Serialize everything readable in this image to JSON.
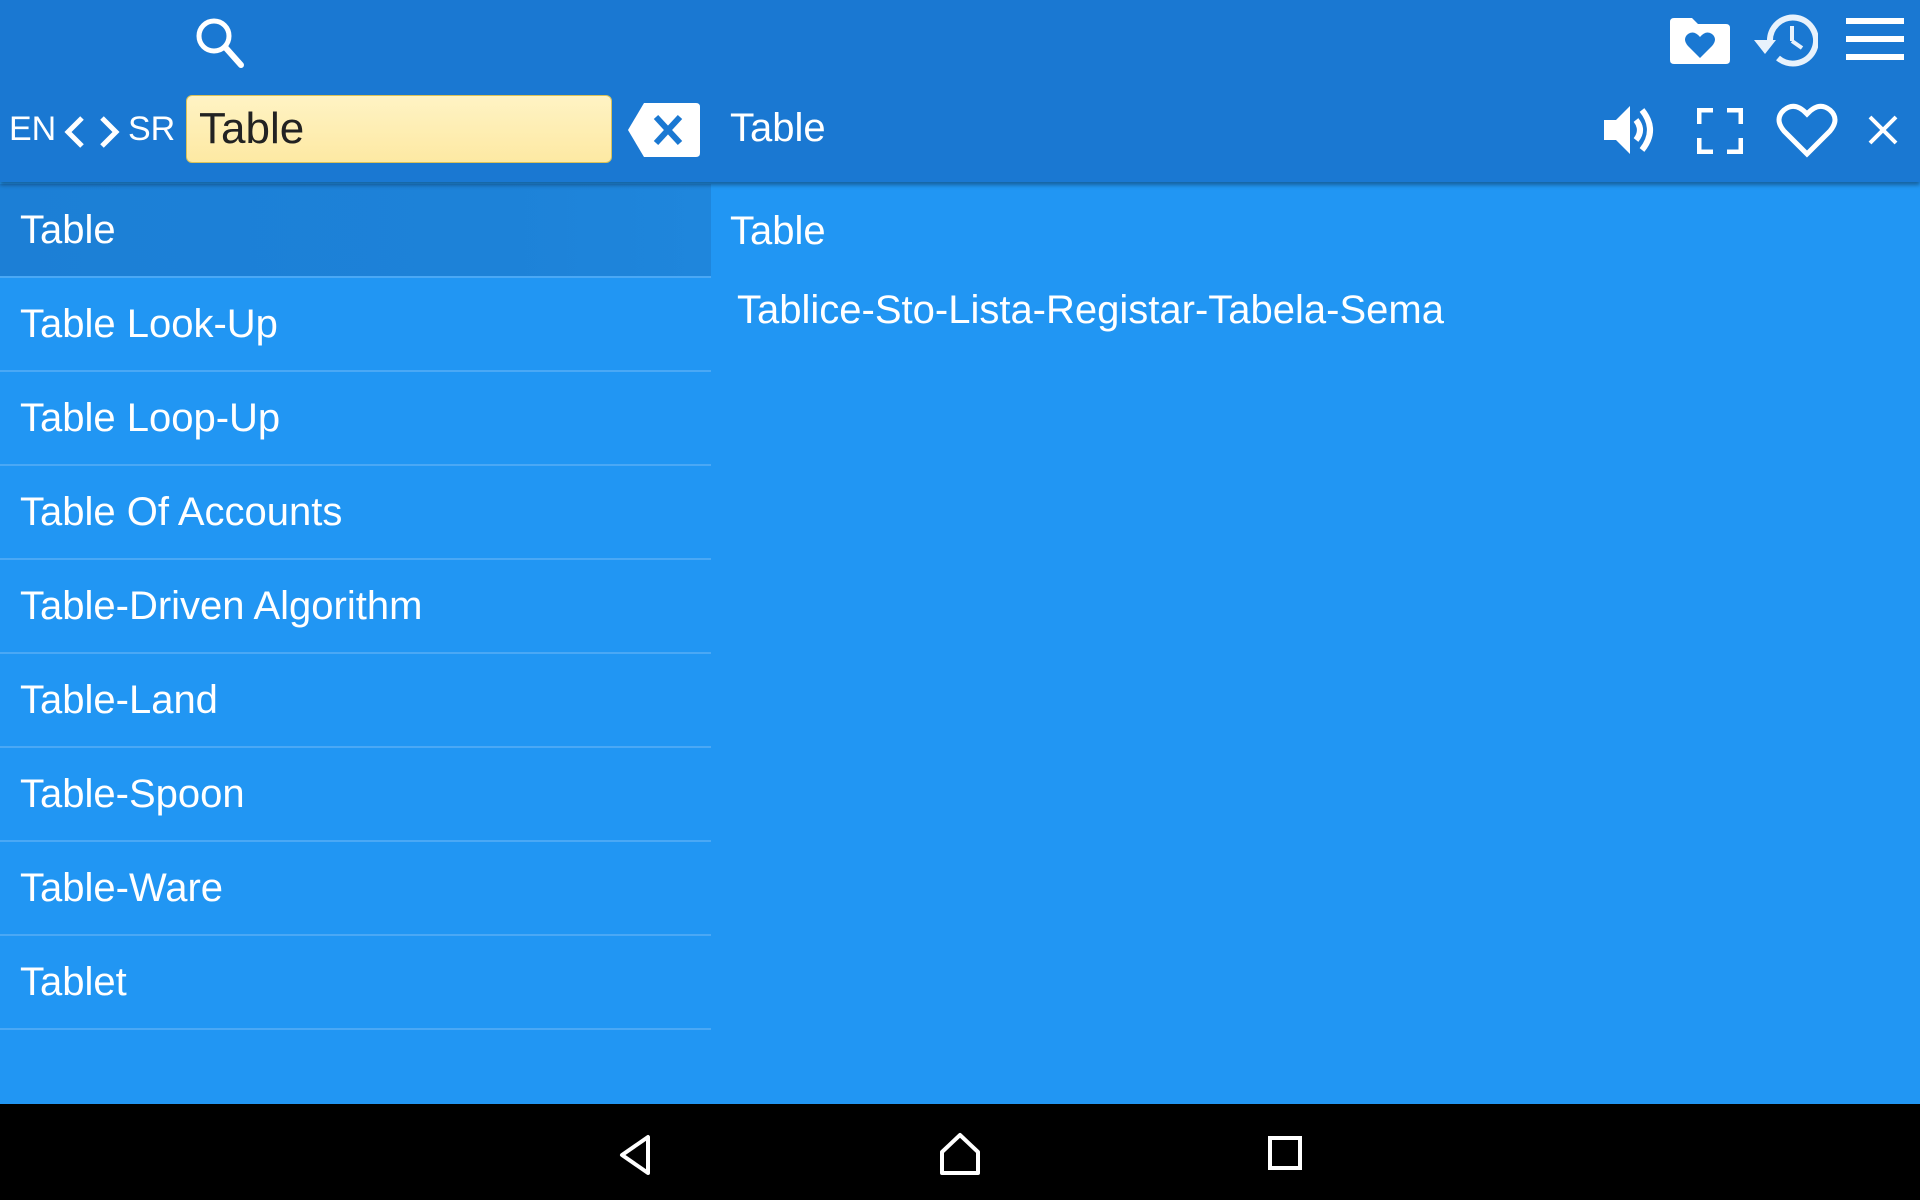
{
  "header": {
    "search_icon": "search-icon",
    "favorites_folder_icon": "folder-heart-icon",
    "history_icon": "history-icon",
    "menu_icon": "hamburger-menu-icon",
    "source_lang": "EN",
    "target_lang": "SR",
    "search": {
      "value": "Table",
      "placeholder": ""
    },
    "current_word": "Table",
    "actions": [
      "speaker-icon",
      "fullscreen-icon",
      "heart-outline-icon",
      "close-icon"
    ]
  },
  "results": [
    {
      "label": "Table",
      "selected": true
    },
    {
      "label": "Table Look-Up"
    },
    {
      "label": "Table Loop-Up"
    },
    {
      "label": "Table Of Accounts"
    },
    {
      "label": "Table-Driven Algorithm"
    },
    {
      "label": "Table-Land"
    },
    {
      "label": "Table-Spoon"
    },
    {
      "label": "Table-Ware"
    },
    {
      "label": "Tablet"
    }
  ],
  "detail": {
    "word": "Table",
    "translation": "Tablice-Sto-Lista-Registar-Tabela-Sema"
  },
  "colors": {
    "header": "#1A78D2",
    "background": "#2196F3",
    "search_field": "#FDEBA8"
  }
}
